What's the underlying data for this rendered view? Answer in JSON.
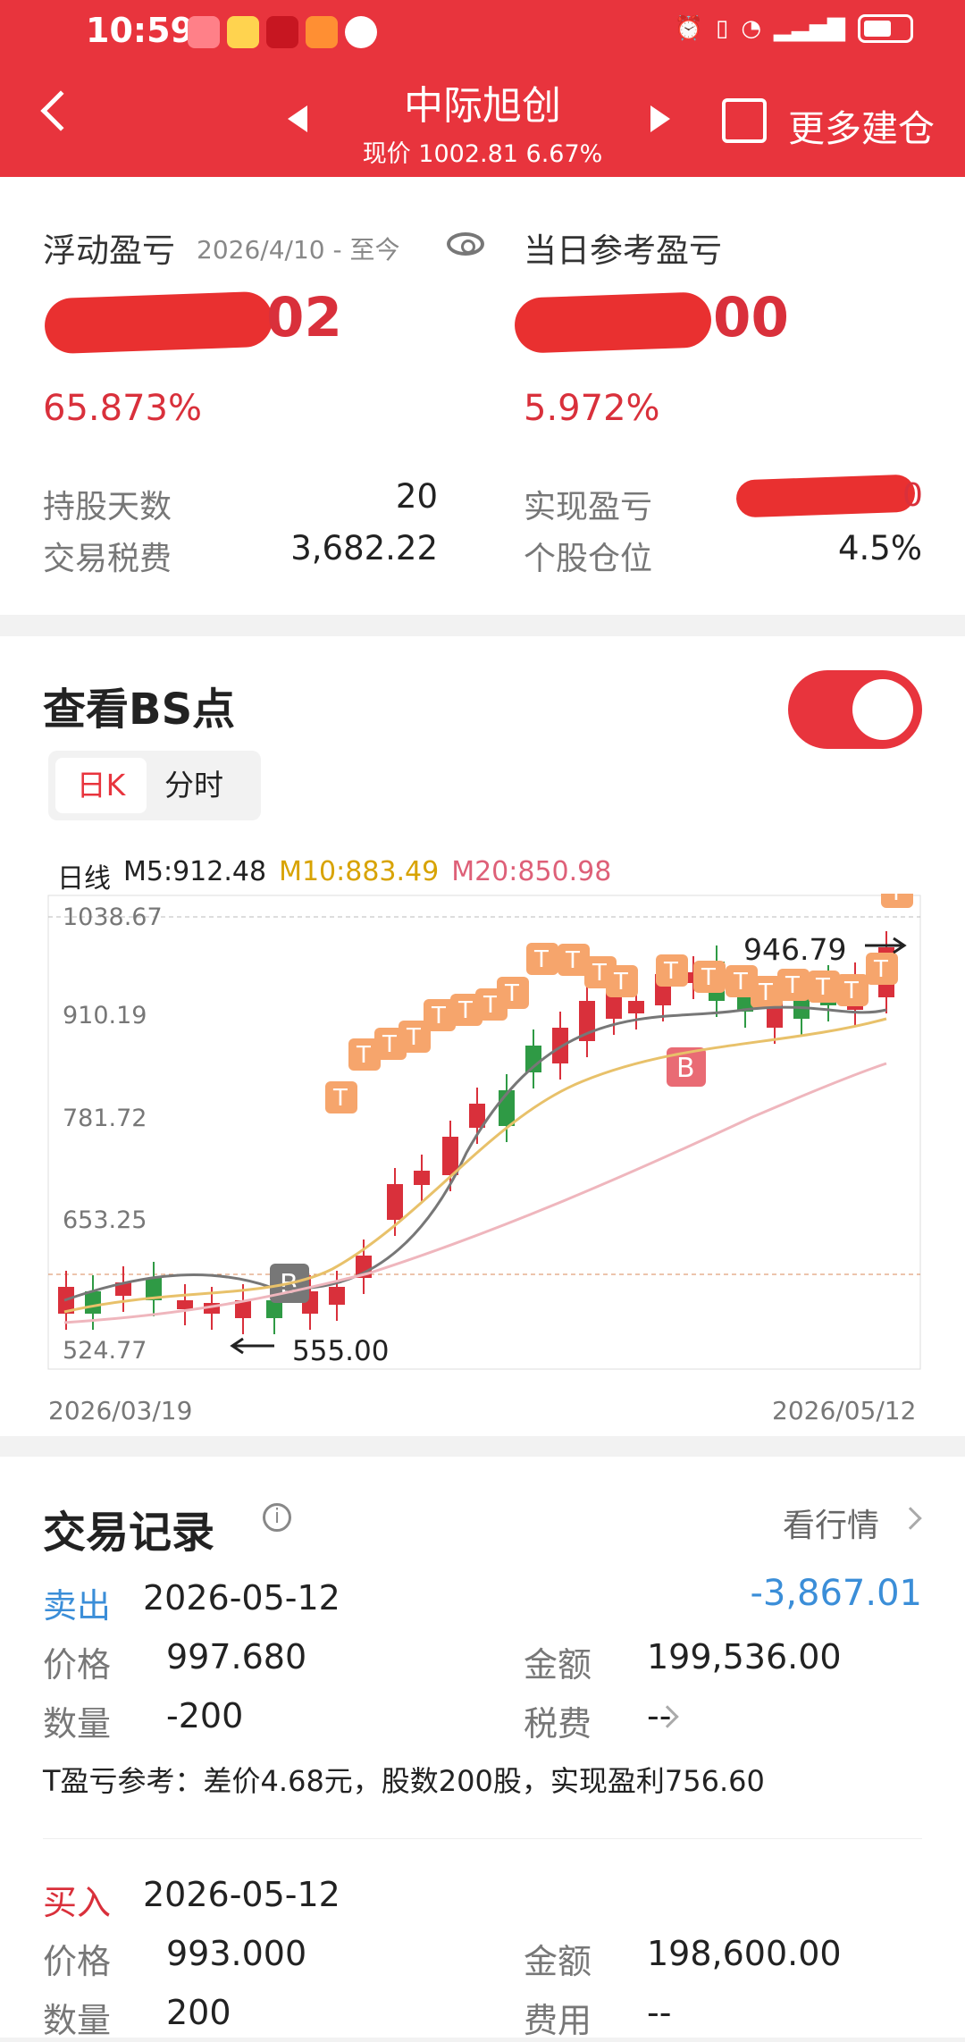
{
  "status": {
    "time": "10:59",
    "icons": [
      "huawei-icon",
      "weibo-icon",
      "heart-icon",
      "video-icon",
      "chat-icon",
      "alarm-icon",
      "vibrate-icon",
      "wifi-icon",
      "5g-signal-icon",
      "battery-icon"
    ]
  },
  "header": {
    "title": "中际旭创",
    "subtitle": "现价 1002.81 6.67%",
    "more": "更多建仓"
  },
  "summary": {
    "floating_label": "浮动盈亏",
    "floating_date": "2026/4/10 - 至今",
    "floating_value_suffix": "02",
    "floating_pct": "65.873%",
    "daily_label": "当日参考盈亏",
    "daily_value_suffix": "00",
    "daily_pct": "5.972%",
    "holding_days_label": "持股天数",
    "holding_days": "20",
    "tax_label": "交易税费",
    "tax": "3,682.22",
    "realized_label": "实现盈亏",
    "realized_suffix": "0",
    "position_label": "个股仓位",
    "position": "4.5%"
  },
  "bs": {
    "title": "查看BS点",
    "tab_day": "日K",
    "tab_time": "分时",
    "ma_title": "日线",
    "m5": "M5:912.48",
    "m10": "M10:883.49",
    "m20": "M20:850.98"
  },
  "chart_data": {
    "type": "candlestick",
    "start": "2026/03/19",
    "end": "2026/05/12",
    "ylim": [
      524.77,
      1038.67
    ],
    "ticks": [
      "1038.67",
      "910.19",
      "781.72",
      "653.25",
      "524.77"
    ],
    "high_label": "946.79",
    "low_label": "555.00",
    "colors": {
      "up": "#d9303b",
      "down": "#2f9a45",
      "m5": "#777777",
      "m10": "#e8c16a",
      "m20": "#efb6bd"
    }
  },
  "trade": {
    "title": "交易记录",
    "look": "看行情",
    "records": [
      {
        "type": "卖出",
        "date": "2026-05-12",
        "amount": "-3,867.01",
        "price_label": "价格",
        "price": "997.680",
        "money_label": "金额",
        "money": "199,536.00",
        "qty_label": "数量",
        "qty": "-200",
        "fee_label": "税费",
        "fee": "--",
        "note": "T盈亏参考：差价4.68元，股数200股，实现盈利756.60"
      },
      {
        "type": "买入",
        "date": "2026-05-12",
        "price_label": "价格",
        "price": "993.000",
        "money_label": "金额",
        "money": "198,600.00",
        "qty_label": "数量",
        "qty": "200",
        "fee_label": "费用",
        "fee": "--"
      }
    ]
  }
}
